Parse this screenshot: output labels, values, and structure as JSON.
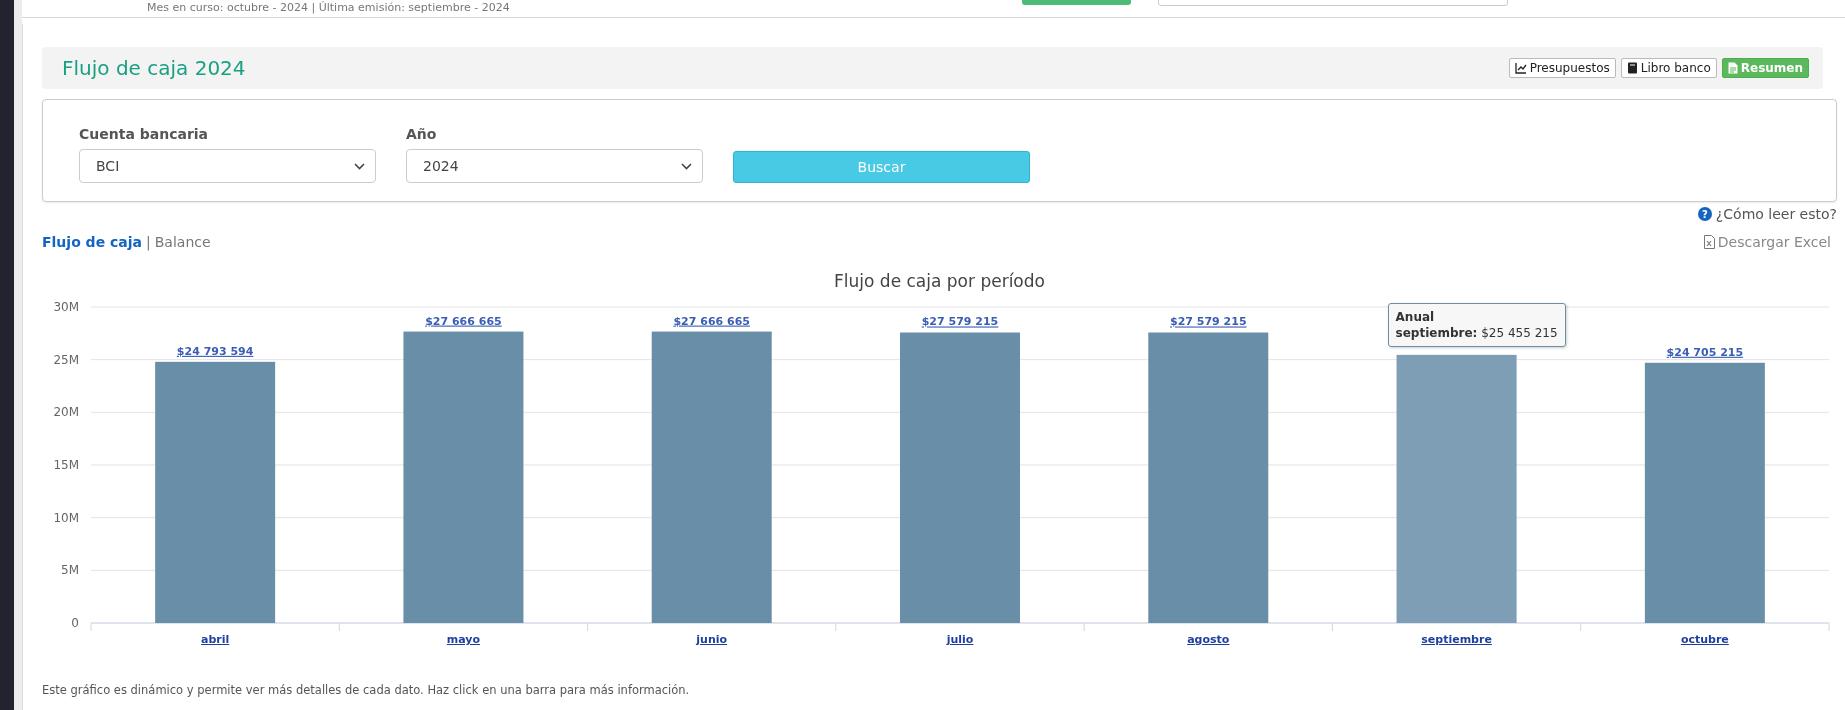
{
  "top_bar": {
    "status": "Mes en curso: octubre - 2024 | Última emisión: septiembre - 2024"
  },
  "header": {
    "title": "Flujo de caja 2024",
    "buttons": [
      {
        "label": "Presupuestos",
        "kind": "chart"
      },
      {
        "label": "Libro banco",
        "kind": "book"
      },
      {
        "label": "Resumen",
        "kind": "document"
      }
    ]
  },
  "filters": {
    "fields": [
      {
        "label": "Cuenta bancaria",
        "value": "BCI"
      },
      {
        "label": "Año",
        "value": "2024"
      }
    ],
    "search_button": "Buscar"
  },
  "help_link": {
    "icon": "?",
    "label": "¿Cómo leer esto?"
  },
  "view_tabs": [
    {
      "label": "Flujo de caja",
      "selected": true
    },
    {
      "label": "Balance",
      "selected": false
    }
  ],
  "tab_separator": "|",
  "download_link": "Descargar Excel",
  "chart": {
    "chart_data": {
      "type": "bar",
      "title": "Flujo de caja por período",
      "categories": [
        "abril",
        "mayo",
        "junio",
        "julio",
        "agosto",
        "septiembre",
        "octubre"
      ],
      "series": [
        {
          "name": "Anual",
          "color": "#688ea8",
          "values": [
            24793594,
            27666665,
            27666665,
            27579215,
            27579215,
            25455215,
            24705215
          ]
        }
      ],
      "ylim": [
        0,
        30000000
      ],
      "grid": true,
      "yticks": [
        {
          "value": 0,
          "label": "0"
        },
        {
          "value": 5000000,
          "label": "5M"
        },
        {
          "value": 10000000,
          "label": "10M"
        },
        {
          "value": 15000000,
          "label": "15M"
        },
        {
          "value": 20000000,
          "label": "20M"
        },
        {
          "value": 25000000,
          "label": "25M"
        },
        {
          "value": 30000000,
          "label": "30M"
        }
      ],
      "value_labels": [
        "$24 793 594",
        "$27 666 665",
        "$27 666 665",
        "$27 579 215",
        "$27 579 215",
        null,
        "$24 705 215"
      ]
    },
    "bar_states": [
      {
        "selected": false
      },
      {
        "selected": false
      },
      {
        "selected": false
      },
      {
        "selected": false
      },
      {
        "selected": false
      },
      {
        "selected": true
      },
      {
        "selected": false
      }
    ],
    "tooltip": {
      "label": "septiembre:",
      "value": "$25 455 215"
    }
  },
  "footnote": "Este gráfico es dinámico y permite ver más detalles de cada dato. Haz click en una barra para más información."
}
